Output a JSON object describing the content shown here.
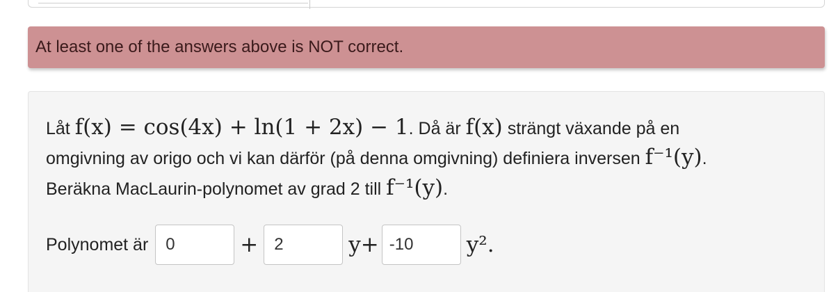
{
  "alert": {
    "message": "At least one of the answers above is NOT correct.",
    "color": "#cd9193"
  },
  "question": {
    "line1_text_a": "Låt ",
    "line1_math_a": "f(x) = cos(4x) + ln(1 + 2x) − 1",
    "line1_text_b": ". Då är ",
    "line1_math_b": "f(x)",
    "line1_text_c": " strängt växande på en",
    "line2_text_a": "omgivning av origo och vi kan därför (på denna omgivning) definiera inversen ",
    "line2_math_a": "f⁻¹(y)",
    "line2_text_b": ".",
    "line3_text_a": "Beräkna MacLaurin-polynomet av grad 2 till ",
    "line3_math_a": "f⁻¹(y)",
    "line3_text_b": "."
  },
  "answer": {
    "label": "Polynomet är",
    "input_1_value": "0",
    "op_plus": "+",
    "input_2_value": "2",
    "op_y_plus": "y+",
    "input_3_value": "-10",
    "op_y2": "y²."
  }
}
